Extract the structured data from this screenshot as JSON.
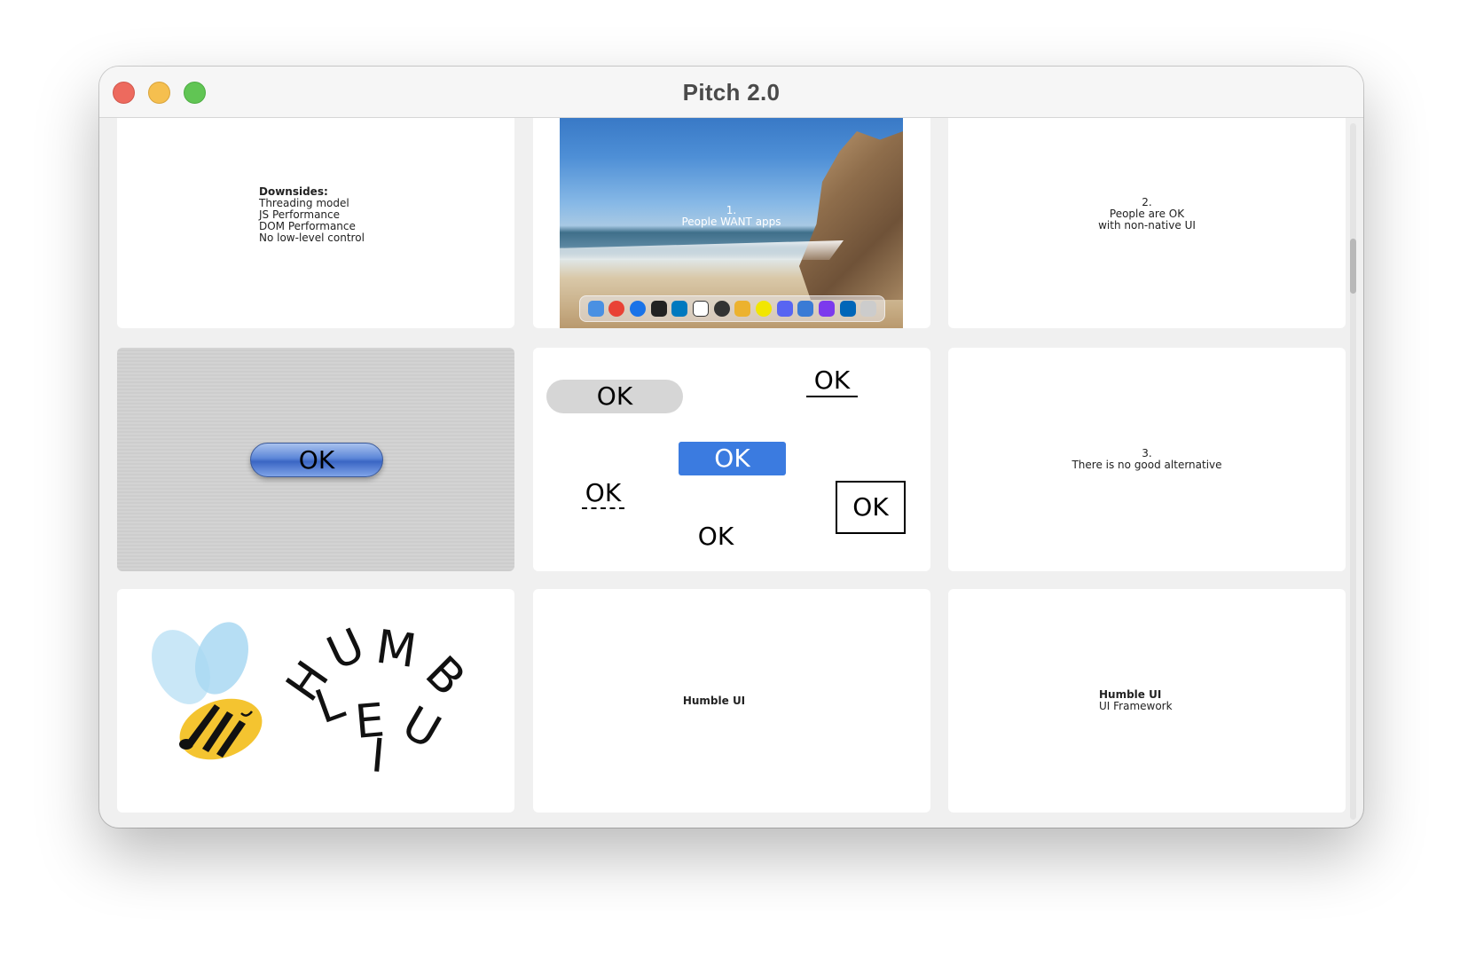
{
  "window": {
    "title": "Pitch 2.0"
  },
  "slides": {
    "downsides": {
      "heading": "Downsides:",
      "lines": [
        "Threading model",
        "JS Performance",
        "DOM Performance",
        "No low-level control"
      ]
    },
    "beach": {
      "number": "1.",
      "text": "People WANT apps"
    },
    "non_native": {
      "number": "2.",
      "line1": "People are OK",
      "line2": "with non-native UI"
    },
    "aqua": {
      "button_label": "OK"
    },
    "ok_variants": {
      "pill": "OK",
      "underline": "OK",
      "blue": "OK",
      "dashed": "OK",
      "boxed": "OK",
      "plain": "OK"
    },
    "no_alternative": {
      "number": "3.",
      "text": "There is no good alternative"
    },
    "logo": {
      "letters": [
        "H",
        "U",
        "M",
        "B",
        "L",
        "E",
        "U",
        "I"
      ]
    },
    "humble_title": {
      "text": "Humble UI"
    },
    "humble_framework": {
      "title": "Humble UI",
      "subtitle": "UI Framework"
    }
  },
  "colors": {
    "close": "#ed6a5e",
    "minimize": "#f5bf4f",
    "maximize": "#61c554",
    "accent_blue": "#3b7be0",
    "bee_yellow": "#f4c430"
  },
  "icons": [
    "close-icon",
    "minimize-icon",
    "maximize-icon",
    "bee-icon"
  ]
}
